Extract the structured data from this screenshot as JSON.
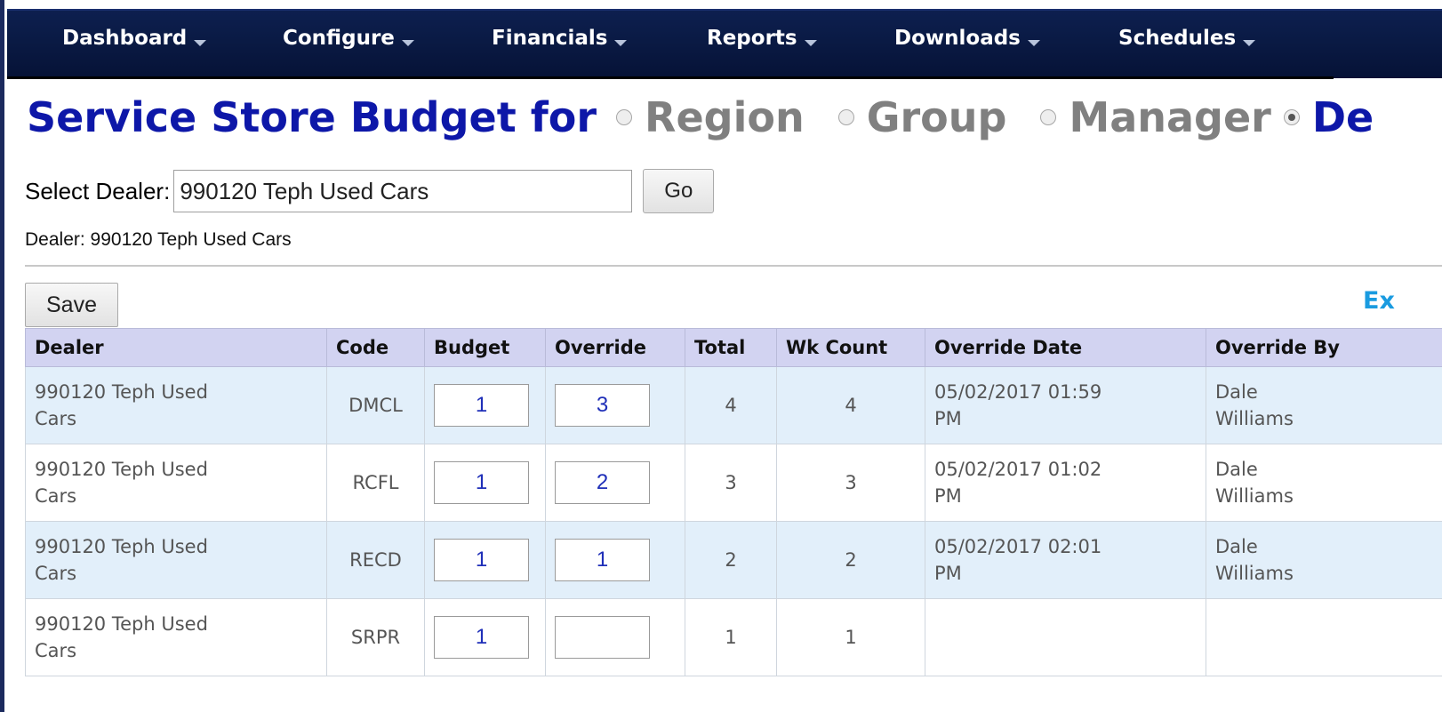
{
  "nav": {
    "items": [
      {
        "label": "Dashboard"
      },
      {
        "label": "Configure"
      },
      {
        "label": "Financials"
      },
      {
        "label": "Reports"
      },
      {
        "label": "Downloads"
      },
      {
        "label": "Schedules"
      }
    ]
  },
  "header": {
    "title": "Service Store Budget for",
    "options": [
      {
        "label": "Region",
        "selected": false
      },
      {
        "label": "Group",
        "selected": false
      },
      {
        "label": "Manager",
        "selected": false
      },
      {
        "label": "De",
        "selected": true
      }
    ]
  },
  "select": {
    "label": "Select Dealer:",
    "value": "990120 Teph Used Cars",
    "go_label": "Go"
  },
  "dealer_text": "Dealer: 990120 Teph Used Cars",
  "toolbar": {
    "save_label": "Save",
    "export_label": "Ex"
  },
  "table": {
    "columns": [
      "Dealer",
      "Code",
      "Budget",
      "Override",
      "Total",
      "Wk Count",
      "Override Date",
      "Override By"
    ],
    "rows": [
      {
        "dealer_line1": "990120 Teph Used",
        "dealer_line2": "Cars",
        "code": "DMCL",
        "budget": "1",
        "override": "3",
        "total": "4",
        "wk_count": "4",
        "date_line1": "05/02/2017 01:59",
        "date_line2": "PM",
        "by_line1": "Dale",
        "by_line2": "Williams"
      },
      {
        "dealer_line1": "990120 Teph Used",
        "dealer_line2": "Cars",
        "code": "RCFL",
        "budget": "1",
        "override": "2",
        "total": "3",
        "wk_count": "3",
        "date_line1": "05/02/2017 01:02",
        "date_line2": "PM",
        "by_line1": "Dale",
        "by_line2": "Williams"
      },
      {
        "dealer_line1": "990120 Teph Used",
        "dealer_line2": "Cars",
        "code": "RECD",
        "budget": "1",
        "override": "1",
        "total": "2",
        "wk_count": "2",
        "date_line1": "05/02/2017 02:01",
        "date_line2": "PM",
        "by_line1": "Dale",
        "by_line2": "Williams"
      },
      {
        "dealer_line1": "990120 Teph Used",
        "dealer_line2": "Cars",
        "code": "SRPR",
        "budget": "1",
        "override": "",
        "total": "1",
        "wk_count": "1",
        "date_line1": "",
        "date_line2": "",
        "by_line1": "",
        "by_line2": ""
      }
    ]
  },
  "colors": {
    "nav_bg": "#0a1a44",
    "title_blue": "#0d17a8",
    "header_row": "#d2d3f1",
    "alt_row": "#e2effa",
    "link_blue": "#1a9be0"
  }
}
